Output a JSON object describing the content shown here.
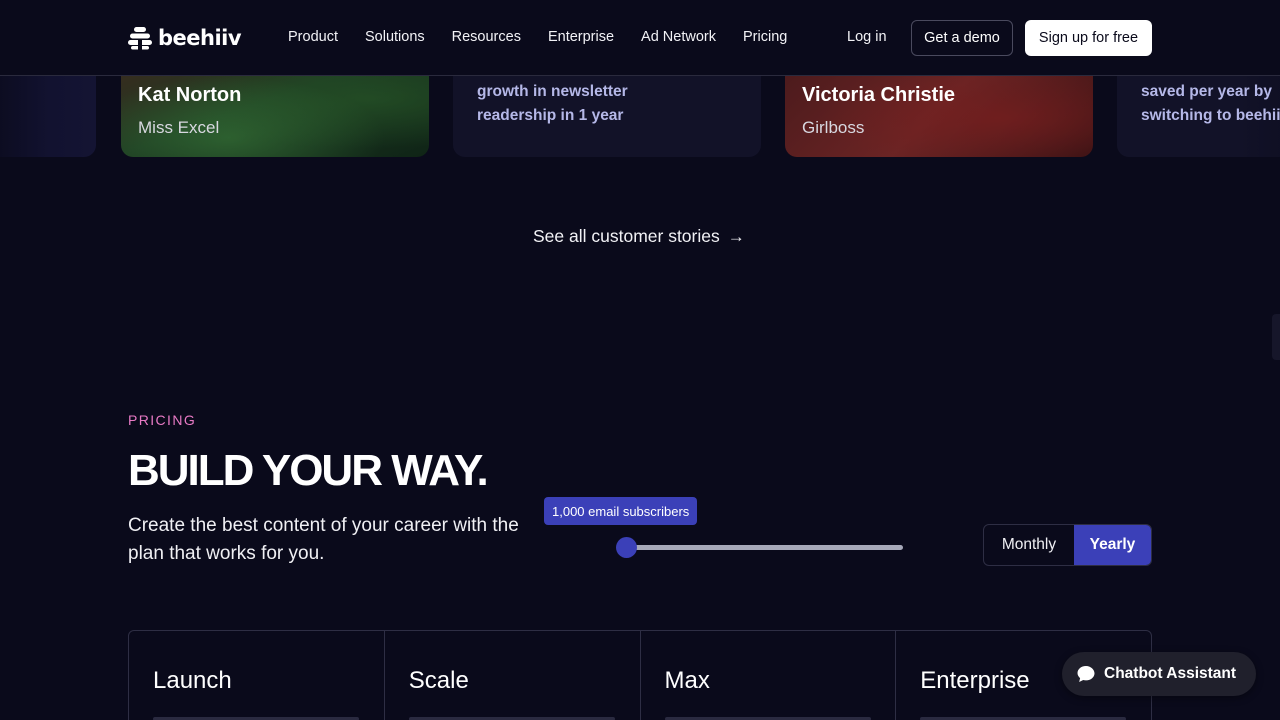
{
  "nav": {
    "logo_text": "beehiiv",
    "links": [
      "Product",
      "Solutions",
      "Resources",
      "Enterprise",
      "Ad Network",
      "Pricing"
    ],
    "login": "Log in",
    "demo": "Get a demo",
    "signup": "Sign up for free"
  },
  "stories": {
    "card1": {
      "name": "Kat Norton",
      "company": "Miss Excel"
    },
    "card2": {
      "stat": "growth in newsletter readership in 1 year"
    },
    "card3": {
      "name": "Victoria Christie",
      "company": "Girlboss"
    },
    "card4": {
      "stat": "saved per year by switching to beehiiv"
    },
    "see_all": "See all customer stories",
    "see_all_icon": "arrow-right-icon"
  },
  "pricing": {
    "eyebrow": "PRICING",
    "headline": "BUILD YOUR WAY.",
    "subtext": "Create the best content of your career with the plan that works for you.",
    "slider": {
      "label": "1,000 email subscribers",
      "value": 0
    },
    "billing": {
      "monthly": "Monthly",
      "yearly": "Yearly",
      "selected": "Yearly"
    },
    "plans": [
      "Launch",
      "Scale",
      "Max",
      "Enterprise"
    ]
  },
  "chatbot": {
    "label": "Chatbot Assistant",
    "icon": "chat-bubble-icon"
  },
  "colors": {
    "background": "#0a0a1b",
    "accent": "#3b40b8",
    "eyebrow": "#e87ac5",
    "stat_text": "#b5b8e8"
  }
}
